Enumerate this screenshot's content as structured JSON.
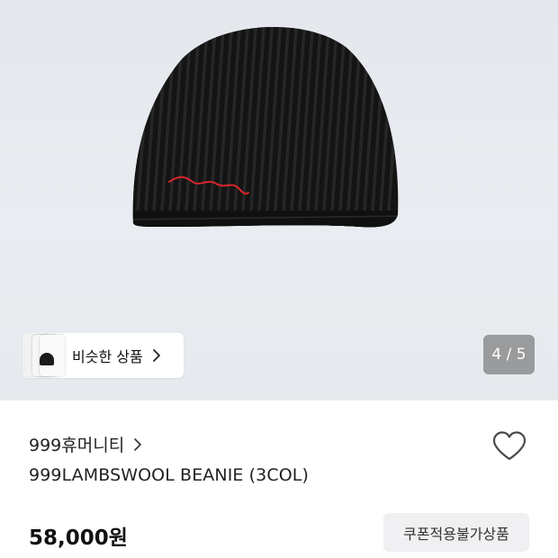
{
  "product_image": {
    "embroidery_text": "999humanity",
    "colors": {
      "knit": "#141414",
      "embroidery": "#d8262b",
      "background": "#e7eaee"
    }
  },
  "similar_products": {
    "label": "비슷한 상품",
    "icon": "chevron-right-icon"
  },
  "gallery": {
    "indicator": "4 / 5",
    "current": 4,
    "total": 5
  },
  "brand": {
    "name": "999휴머니티",
    "icon": "chevron-right-icon"
  },
  "wishlist": {
    "icon": "heart-outline-icon",
    "active": false
  },
  "product": {
    "title": "999LAMBSWOOL BEANIE (3COL)",
    "price": "58,000원"
  },
  "coupon_badge": {
    "label": "쿠폰적용불가상품"
  }
}
